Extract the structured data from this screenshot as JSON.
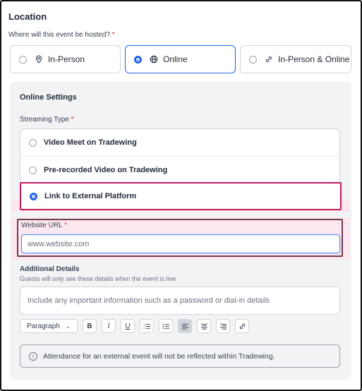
{
  "location": {
    "title": "Location",
    "question": "Where will this event be hosted?",
    "required_mark": "*",
    "options": [
      {
        "label": "In-Person",
        "icon": "pin-icon",
        "selected": false
      },
      {
        "label": "Online",
        "icon": "globe-icon",
        "selected": true
      },
      {
        "label": "In-Person & Online",
        "icon": "link-icon",
        "selected": false
      }
    ]
  },
  "online_settings": {
    "title": "Online Settings",
    "streaming_type_label": "Streaming Type",
    "required_mark": "*",
    "streaming_options": [
      {
        "label": "Video Meet on Tradewing",
        "selected": false
      },
      {
        "label": "Pre-recorded Video on Tradewing",
        "selected": false
      },
      {
        "label": "Link to External Platform",
        "selected": true
      }
    ],
    "website_url": {
      "label": "Website URL",
      "required_mark": "*",
      "value": "",
      "placeholder": "www.website.com"
    },
    "additional_details": {
      "label": "Additional Details",
      "sublabel": "Guests will only see these details when the event is live",
      "value": "",
      "placeholder": "Include any important information such as a password or dial-in details"
    },
    "toolbar": {
      "format_select": "Paragraph",
      "bold": "B",
      "italic": "I",
      "underline": "U",
      "buttons": [
        "bold-icon",
        "italic-icon",
        "underline-icon",
        "ordered-list-icon",
        "bullet-list-icon",
        "align-left-icon",
        "align-center-icon",
        "align-right-icon",
        "link-icon"
      ],
      "active_button": "align-left-icon"
    },
    "notice": {
      "text": "Attendance for an external event will not be reflected within Tradewing.",
      "icon": "info-icon"
    }
  },
  "colors": {
    "accent": "#2563eb",
    "highlight_outline": "#c2185b",
    "url_outline": "#6d3b54",
    "highlight_band": "#fde7ef",
    "panel_bg": "#f2f3f5",
    "required": "#dc2626"
  }
}
